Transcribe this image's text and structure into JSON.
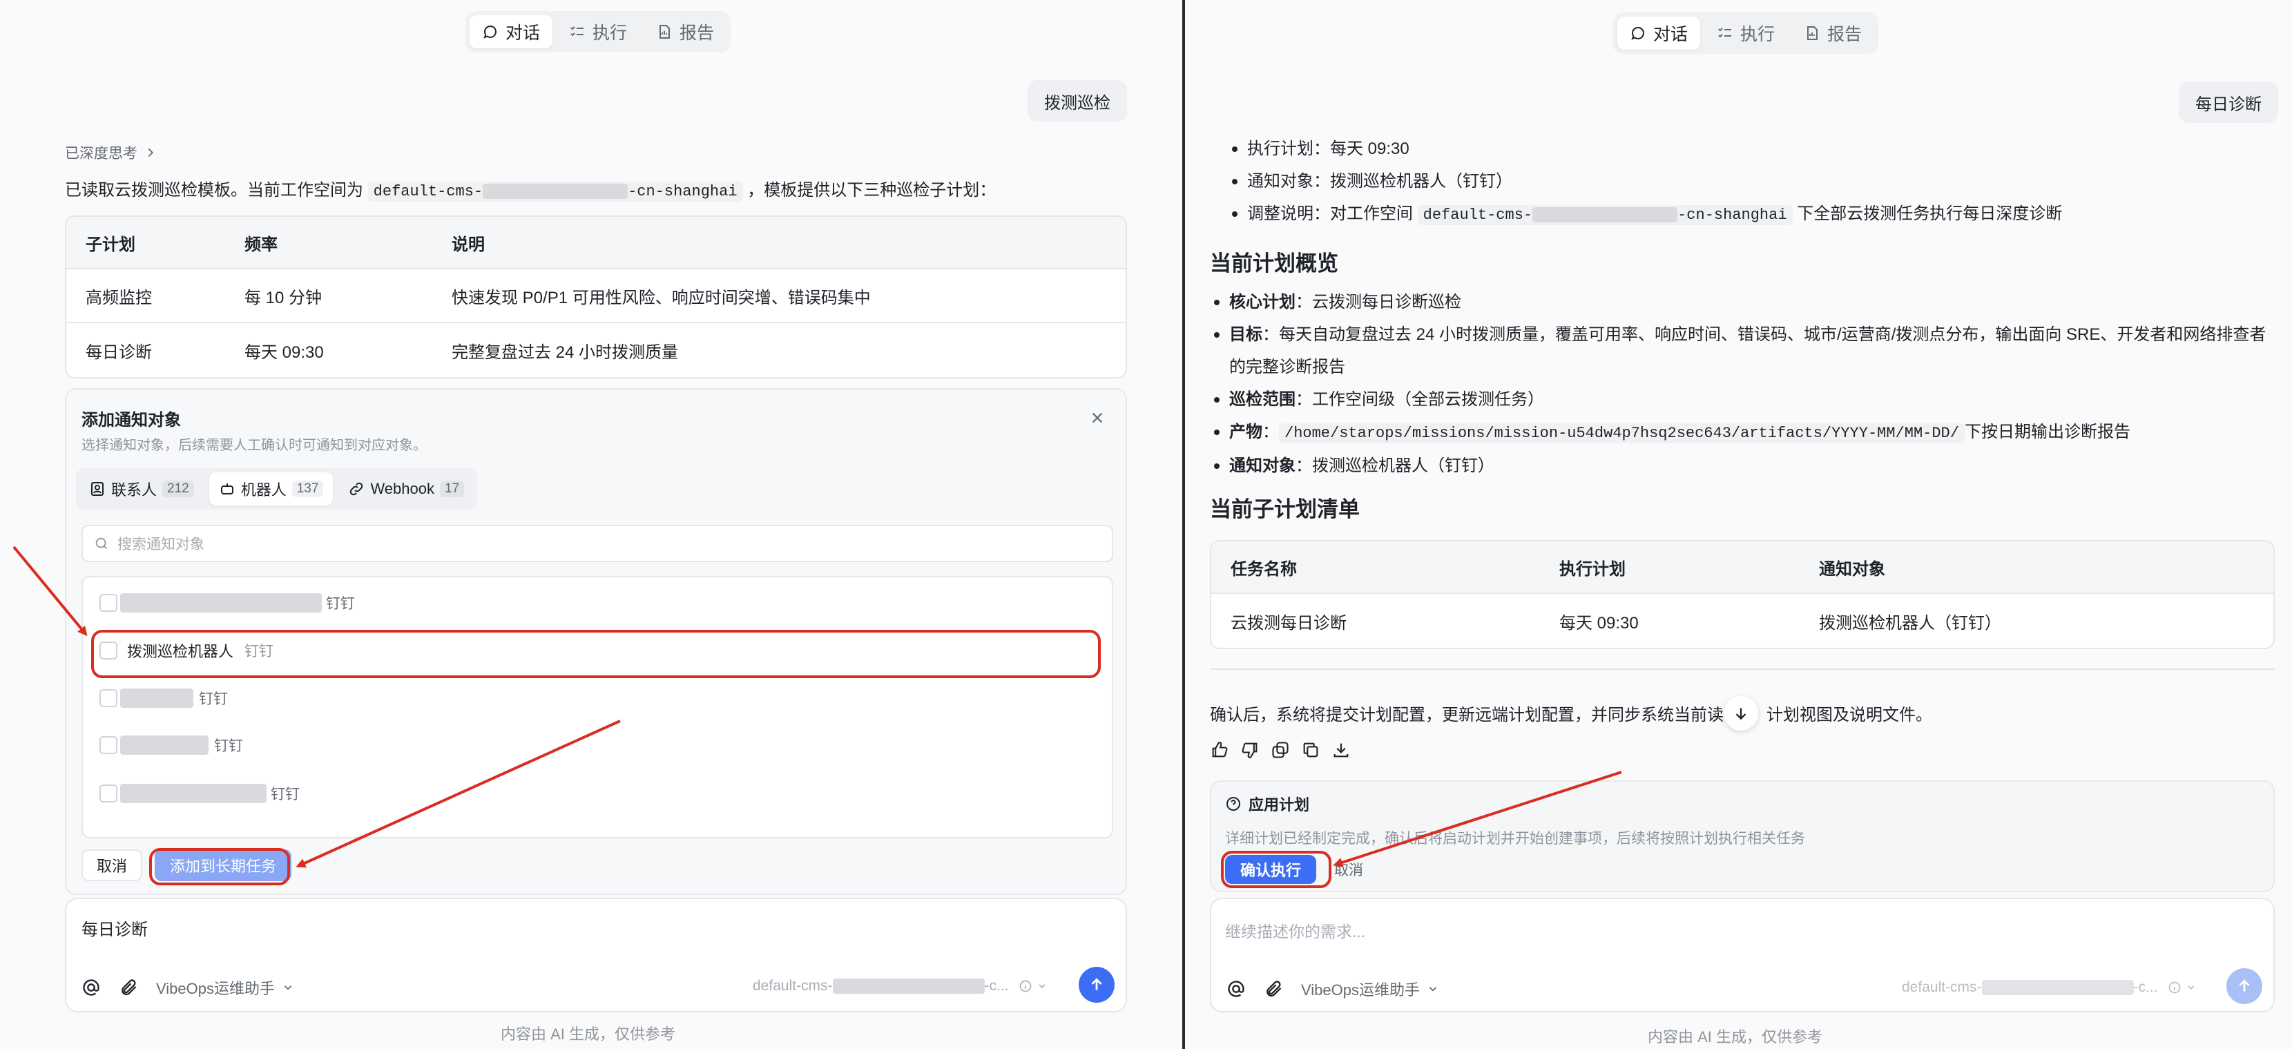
{
  "left": {
    "tabs": [
      {
        "label": "对话",
        "active": true,
        "icon": "chat-icon"
      },
      {
        "label": "执行",
        "active": false,
        "icon": "checklist-icon"
      },
      {
        "label": "报告",
        "active": false,
        "icon": "report-icon"
      }
    ],
    "user_message": "拨测巡检",
    "thinking_label": "已深度思考",
    "intro_prefix": "已读取云拨测巡检模板。当前工作空间为",
    "workspace_code_prefix": "default-cms-",
    "workspace_code_suffix": "-cn-shanghai",
    "intro_suffix": "，模板提供以下三种巡检子计划：",
    "table": {
      "headers": [
        "子计划",
        "频率",
        "说明"
      ],
      "rows": [
        [
          "高频监控",
          "每 10 分钟",
          "快速发现 P0/P1 可用性风险、响应时间突增、错误码集中"
        ],
        [
          "每日诊断",
          "每天 09:30",
          "完整复盘过去 24 小时拨测质量"
        ]
      ]
    },
    "notify_dialog": {
      "title": "添加通知对象",
      "subtitle": "选择通知对象，后续需要人工确认时可通知到对应对象。",
      "tabs": [
        {
          "label": "联系人",
          "count": "212",
          "icon": "contact-icon"
        },
        {
          "label": "机器人",
          "count": "137",
          "icon": "robot-icon",
          "active": true
        },
        {
          "label": "Webhook",
          "count": "17",
          "icon": "link-icon"
        }
      ],
      "search_placeholder": "搜索通知对象",
      "items": [
        {
          "name": "",
          "tag": "钉钉",
          "masked": true
        },
        {
          "name": "拨测巡检机器人",
          "tag": "钉钉",
          "masked": false,
          "highlighted": true
        },
        {
          "name": "",
          "tag": "钉钉",
          "masked": true
        },
        {
          "name": "",
          "tag": "钉钉",
          "masked": true
        },
        {
          "name": "",
          "tag": "钉钉",
          "masked": true
        }
      ],
      "cancel_label": "取消",
      "add_label": "添加到长期任务"
    },
    "composer": {
      "value": "每日诊断",
      "agent_label": "VibeOps运维助手",
      "workspace_prefix": "default-cms-",
      "workspace_suffix": "-c..."
    },
    "footer": "内容由 AI 生成，仅供参考"
  },
  "right": {
    "tabs": [
      {
        "label": "对话",
        "active": true,
        "icon": "chat-icon"
      },
      {
        "label": "执行",
        "active": false,
        "icon": "checklist-icon"
      },
      {
        "label": "报告",
        "active": false,
        "icon": "report-icon"
      }
    ],
    "user_message": "每日诊断",
    "top_bullets": [
      {
        "key": "执行计划：",
        "value": "每天 09:30"
      },
      {
        "key": "通知对象：",
        "value": "拨测巡检机器人（钉钉）"
      },
      {
        "key": "调整说明：",
        "value_prefix": "对工作空间",
        "code_prefix": "default-cms-",
        "code_suffix": "-cn-shanghai",
        "value_suffix": "下全部云拨测任务执行每日深度诊断"
      }
    ],
    "overview_title": "当前计划概览",
    "overview": [
      {
        "key": "核心计划",
        "value": "：云拨测每日诊断巡检"
      },
      {
        "key": "目标",
        "value": "：每天自动复盘过去 24 小时拨测质量，覆盖可用率、响应时间、错误码、城市/运营商/拨测点分布，输出面向 SRE、开发者和网络排查者的完整诊断报告"
      },
      {
        "key": "巡检范围",
        "value": "：工作空间级（全部云拨测任务）"
      },
      {
        "key": "产物",
        "value_prefix": "：",
        "code": "/home/starops/missions/mission-u54dw4p7hsq2sec643/artifacts/YYYY-MM/MM-DD/",
        "value_suffix": "下按日期输出诊断报告"
      },
      {
        "key": "通知对象",
        "value": "：拨测巡检机器人（钉钉）"
      }
    ],
    "subplans_title": "当前子计划清单",
    "subplans_table": {
      "headers": [
        "任务名称",
        "执行计划",
        "通知对象"
      ],
      "rows": [
        [
          "云拨测每日诊断",
          "每天 09:30",
          "拨测巡检机器人（钉钉）"
        ]
      ]
    },
    "confirm_text_a": "确认后，系统将提交计划配置，更新远端计划配置，并同步系统当前读",
    "confirm_text_b": "计划视图及说明文件。",
    "apply_card": {
      "title": "应用计划",
      "description": "详细计划已经制定完成，确认后将启动计划并开始创建事项，后续将按照计划执行相关任务",
      "confirm_label": "确认执行",
      "cancel_label": "取消"
    },
    "composer": {
      "placeholder": "继续描述你的需求...",
      "agent_label": "VibeOps运维助手",
      "workspace_prefix": "default-cms-",
      "workspace_suffix": "-c..."
    },
    "footer": "内容由 AI 生成，仅供参考"
  },
  "colors": {
    "accent": "#3b6ef5",
    "annotation": "#d92d20",
    "add_button": "#8aa7f5"
  }
}
